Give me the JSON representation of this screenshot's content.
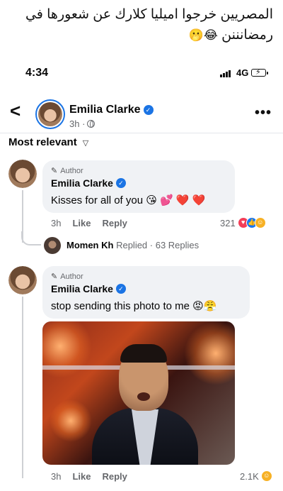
{
  "caption": {
    "text": "المصريين خرجوا اميليا كلارك عن شعورها في رمضانننن",
    "emojis": "😂🫢"
  },
  "statusbar": {
    "time": "4:34",
    "network": "4G"
  },
  "header": {
    "name": "Emilia Clarke",
    "time": "3h ·"
  },
  "sort": {
    "label": "Most relevant"
  },
  "comments": [
    {
      "author_badge": "Author",
      "name": "Emilia Clarke",
      "text": "Kisses for all of you 😘 💕 ❤️ ❤️",
      "time": "3h",
      "like": "Like",
      "reply": "Reply",
      "reaction_count": "321"
    },
    {
      "author_badge": "Author",
      "name": "Emilia Clarke",
      "text": "stop sending this photo to me 😡😤",
      "time": "3h",
      "like": "Like",
      "reply": "Reply",
      "reaction_count": "2.1K"
    }
  ],
  "reply_summary": {
    "name": "Momen Kh",
    "text": "Replied · 63 Replies"
  },
  "colors": {
    "brand_blue": "#1b74e4",
    "bubble_bg": "#f0f2f5",
    "muted_text": "#65676b"
  }
}
